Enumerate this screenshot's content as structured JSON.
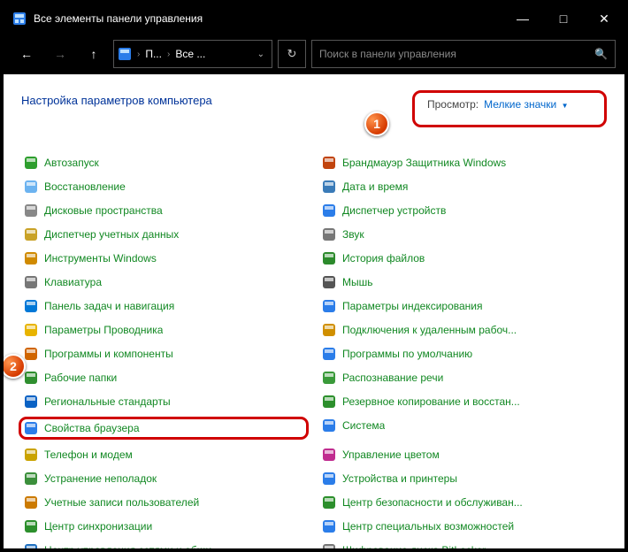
{
  "window": {
    "title": "Все элементы панели управления",
    "min": "—",
    "max": "□",
    "close": "✕"
  },
  "nav": {
    "back": "←",
    "forward": "→",
    "up": "↑",
    "refresh": "↻",
    "breadcrumb": {
      "seg1": "П...",
      "seg2": "Все ..."
    },
    "search_placeholder": "Поиск в панели управления"
  },
  "header": {
    "title": "Настройка параметров компьютера",
    "view_label": "Просмотр:",
    "view_value": "Мелкие значки"
  },
  "callouts": {
    "c1": "1",
    "c2": "2"
  },
  "colors": {
    "accent_red": "#d00000",
    "link_green": "#118822",
    "link_blue": "#0066cc"
  },
  "items": {
    "left": [
      {
        "icon": "autorun-icon",
        "label": "Автозапуск"
      },
      {
        "icon": "recovery-icon",
        "label": "Восстановление"
      },
      {
        "icon": "storage-icon",
        "label": "Дисковые пространства"
      },
      {
        "icon": "credentials-icon",
        "label": "Диспетчер учетных данных"
      },
      {
        "icon": "tools-icon",
        "label": "Инструменты Windows"
      },
      {
        "icon": "keyboard-icon",
        "label": "Клавиатура"
      },
      {
        "icon": "taskbar-icon",
        "label": "Панель задач и навигация"
      },
      {
        "icon": "explorer-opts-icon",
        "label": "Параметры Проводника"
      },
      {
        "icon": "programs-icon",
        "label": "Программы и компоненты"
      },
      {
        "icon": "workfolders-icon",
        "label": "Рабочие папки"
      },
      {
        "icon": "region-icon",
        "label": "Региональные стандарты"
      },
      {
        "icon": "internet-opts-icon",
        "label": "Свойства браузера",
        "hl": true
      },
      {
        "icon": "phone-icon",
        "label": "Телефон и модем"
      },
      {
        "icon": "troubleshoot-icon",
        "label": "Устранение неполадок"
      },
      {
        "icon": "users-icon",
        "label": "Учетные записи пользователей"
      },
      {
        "icon": "sync-icon",
        "label": "Центр синхронизации"
      },
      {
        "icon": "network-icon",
        "label": "Центр управления сетями и общи..."
      }
    ],
    "right": [
      {
        "icon": "firewall-icon",
        "label": "Брандмауэр Защитника Windows"
      },
      {
        "icon": "datetime-icon",
        "label": "Дата и время"
      },
      {
        "icon": "devmgr-icon",
        "label": "Диспетчер устройств"
      },
      {
        "icon": "sound-icon",
        "label": "Звук"
      },
      {
        "icon": "history-icon",
        "label": "История файлов"
      },
      {
        "icon": "mouse-icon",
        "label": "Мышь"
      },
      {
        "icon": "indexing-icon",
        "label": "Параметры индексирования"
      },
      {
        "icon": "remote-icon",
        "label": "Подключения к удаленным рабоч..."
      },
      {
        "icon": "defaults-icon",
        "label": "Программы по умолчанию"
      },
      {
        "icon": "speech-icon",
        "label": "Распознавание речи"
      },
      {
        "icon": "backup-icon",
        "label": "Резервное копирование и восстан..."
      },
      {
        "icon": "system-icon",
        "label": "Система"
      },
      {
        "icon": "color-icon",
        "label": "Управление цветом"
      },
      {
        "icon": "printers-icon",
        "label": "Устройства и принтеры"
      },
      {
        "icon": "security-icon",
        "label": "Центр безопасности и обслуживан..."
      },
      {
        "icon": "access-icon",
        "label": "Центр специальных возможностей"
      },
      {
        "icon": "bitlocker-icon",
        "label": "Шифрование диска BitLocker"
      }
    ]
  }
}
